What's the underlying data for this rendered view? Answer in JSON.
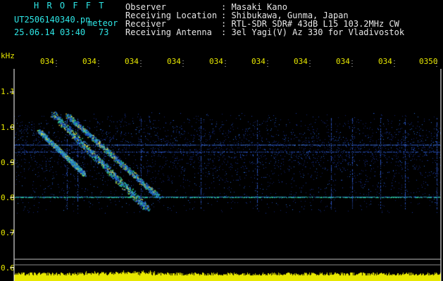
{
  "header": {
    "hrofft": "H R O F F T",
    "filename": "UT2506140340.pn",
    "meteor_label": "meteor",
    "datetime": "25.06.14 03:40",
    "count": "73"
  },
  "info": [
    {
      "label": "Observer",
      "value": ": Masaki Kano"
    },
    {
      "label": "Receiving Location",
      "value": ": Shibukawa, Gunma, Japan"
    },
    {
      "label": "Receiver",
      "value": ": RTL-SDR SDR# 43dB L15 103.2MHz CW"
    },
    {
      "label": "Receiving Antenna",
      "value": ": 3el Yagi(V) Az 330 for Vladivostok"
    }
  ],
  "axis": {
    "unit": "kHz",
    "y_labels": [
      "1.1",
      "1.0",
      "0.9",
      "0.8",
      "0.7",
      "0.6"
    ],
    "x_labels": [
      "034",
      "034",
      "034",
      "034",
      "034",
      "034",
      "034",
      "034",
      "034",
      "0350"
    ]
  },
  "colors": {
    "background": "#000000",
    "cyan": "#2ee6e6",
    "yellow": "#e8e800",
    "text": "#e8e8e8"
  }
}
